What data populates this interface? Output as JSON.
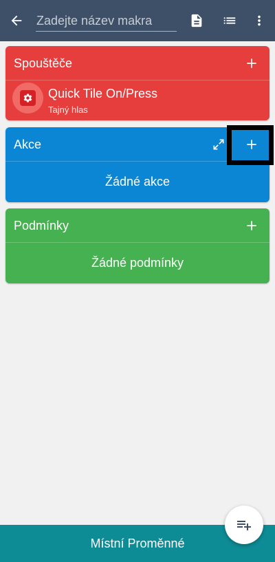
{
  "header": {
    "title_placeholder": "Zadejte název makra",
    "icons": [
      "back-arrow-icon",
      "document-icon",
      "list-icon",
      "more-vert-icon"
    ]
  },
  "sections": {
    "triggers": {
      "title": "Spouštěče",
      "color": "#e53e3c",
      "item": {
        "name": "Quick Tile On/Press",
        "subtitle": "Tajný hlas",
        "icon": "quick-tile-icon"
      }
    },
    "actions": {
      "title": "Akce",
      "color": "#0a86d5",
      "empty_text": "Žádné akce"
    },
    "conditions": {
      "title": "Podmínky",
      "color": "#45b151",
      "empty_text": "Žádné podmínky"
    }
  },
  "bottom_bar": {
    "label": "Místní Proměnné",
    "color": "#0e8c95"
  },
  "fab": {
    "icon": "playlist-add-icon"
  }
}
